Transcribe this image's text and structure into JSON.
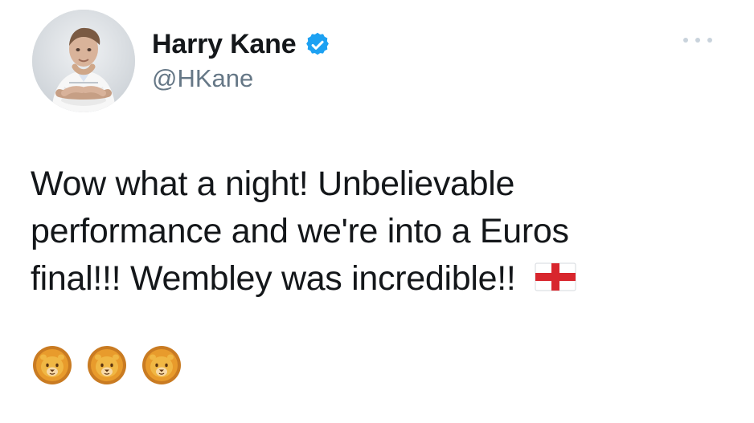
{
  "tweet": {
    "display_name": "Harry Kane",
    "handle": "@HKane",
    "verified": true,
    "text_lines": [
      "Wow what a night! Unbelievable",
      "performance and we're into a Euros",
      "final!!! Wembley was incredible!!"
    ],
    "flag_emoji_name": "flag-england-icon",
    "trailing_emojis": [
      "lion-face-icon",
      "lion-face-icon",
      "lion-face-icon"
    ]
  },
  "icons": {
    "verified": "verified-badge-icon",
    "more": "more-options-icon"
  },
  "colors": {
    "name": "#14171a",
    "handle": "#657786",
    "verified_blue": "#1da1f2",
    "more_dots": "#c9d3dc"
  }
}
